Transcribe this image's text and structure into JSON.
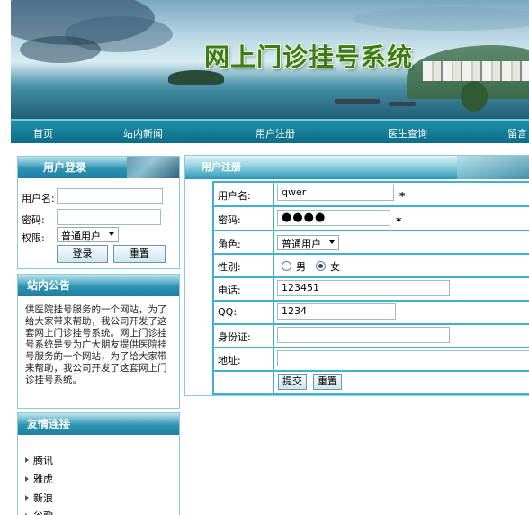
{
  "header": {
    "title": "网上门诊挂号系统"
  },
  "nav": [
    {
      "label": "首页"
    },
    {
      "label": "站内新闻"
    },
    {
      "label": "用户注册"
    },
    {
      "label": "医生查询"
    },
    {
      "label": "留言"
    }
  ],
  "login": {
    "title": "用户登录",
    "username_label": "用户名:",
    "password_label": "密码:",
    "role_label": "权限:",
    "role_value": "普通用户",
    "login_button": "登录",
    "reset_button": "重置"
  },
  "notice": {
    "title": "站内公告",
    "text": "供医院挂号服务的一个网站，为了给大家带来帮助，我公司开发了这套网上门诊挂号系统。网上门诊挂号系统是专为广大朋友提供医院挂号服务的一个网站，为了给大家带来帮助，我公司开发了这套网上门诊挂号系统。"
  },
  "links": {
    "title": "友情连接",
    "items": [
      "腾讯",
      "雅虎",
      "新浪",
      "谷歌"
    ]
  },
  "register": {
    "title": "用户注册",
    "username_label": "用户名:",
    "username_value": "qwer",
    "password_label": "密码:",
    "password_value": "●●●●",
    "required_mark": "*",
    "role_label": "角色:",
    "role_value": "普通用户",
    "gender_label": "性别:",
    "gender_options": [
      "男",
      "女"
    ],
    "gender_selected": "女",
    "phone_label": "电话:",
    "phone_value": "123451",
    "qq_label": "QQ:",
    "qq_value": "1234",
    "idcard_label": "身份证:",
    "idcard_value": "",
    "address_label": "地址:",
    "address_value": "",
    "submit_button": "提交",
    "reset_button": "重置"
  }
}
